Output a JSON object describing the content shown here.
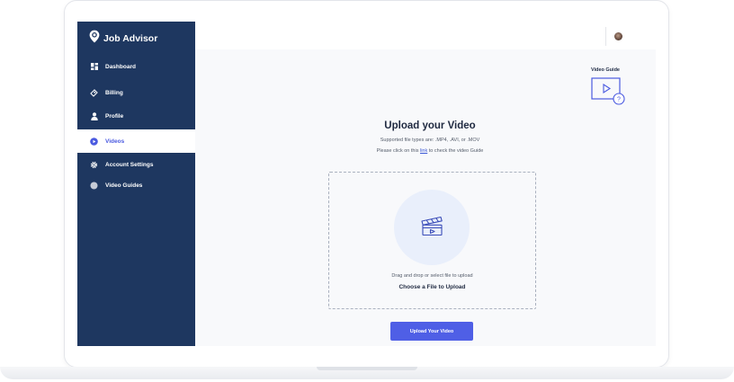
{
  "app": {
    "name": "Job Advisor"
  },
  "sidebar": {
    "items": [
      {
        "label": "Dashboard",
        "icon": "grid-icon"
      },
      {
        "label": "Billing",
        "icon": "wallet-icon"
      },
      {
        "label": "Profile",
        "icon": "user-icon"
      },
      {
        "label": "Videos",
        "icon": "play-circle-icon",
        "active": true
      },
      {
        "label": "Account Settings",
        "icon": "gear-icon"
      },
      {
        "label": "Video Guides",
        "icon": "circle-icon"
      }
    ]
  },
  "header": {
    "avatar": "user-avatar"
  },
  "video_guide": {
    "label": "Video Guide",
    "icon": "video-help-icon"
  },
  "upload": {
    "title": "Upload your Video",
    "supported": "Supported file types are:  .MP4, .AVI, or .MOV",
    "guide_prefix": "Please click on this",
    "guide_link": "link",
    "guide_suffix": "to check the video Guide",
    "drop_hint": "Drag and drop or select file to upload",
    "choose_label": "Choose a File to Upload",
    "button_label": "Upload Your Video"
  },
  "colors": {
    "sidebar": "#1e3760",
    "accent": "#4f5fe6",
    "content_bg": "#f8f9fb",
    "drop_circle": "#e9effb"
  }
}
